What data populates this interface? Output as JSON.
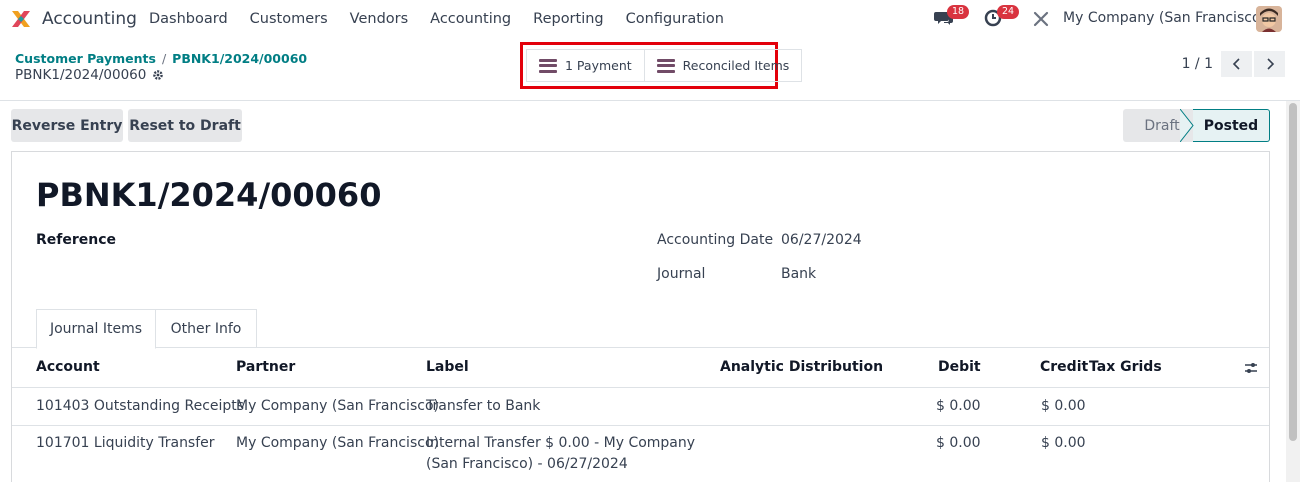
{
  "nav": {
    "app_name": "Accounting",
    "menu": [
      "Dashboard",
      "Customers",
      "Vendors",
      "Accounting",
      "Reporting",
      "Configuration"
    ],
    "messages_count": "18",
    "activities_count": "24",
    "company": "My Company (San Francisco)"
  },
  "breadcrumb": {
    "parent": "Customer Payments",
    "current": "PBNK1/2024/00060",
    "separator": "/"
  },
  "record_name": "PBNK1/2024/00060",
  "smart_buttons": {
    "payment": "1 Payment",
    "reconciled": "Reconciled Items"
  },
  "pager": {
    "value": "1 / 1"
  },
  "actions": {
    "reverse": "Reverse Entry",
    "reset": "Reset to Draft"
  },
  "statusbar": {
    "draft": "Draft",
    "posted": "Posted",
    "current": "Posted"
  },
  "form": {
    "title": "PBNK1/2024/00060",
    "reference_label": "Reference",
    "accounting_date_label": "Accounting Date",
    "accounting_date": "06/27/2024",
    "journal_label": "Journal",
    "journal": "Bank"
  },
  "tabs": [
    "Journal Items",
    "Other Info"
  ],
  "table": {
    "headers": {
      "account": "Account",
      "partner": "Partner",
      "label": "Label",
      "analytic": "Analytic Distribution",
      "debit": "Debit",
      "credit": "Credit",
      "tax": "Tax Grids"
    },
    "rows": [
      {
        "account": "101403 Outstanding Receipts",
        "partner": "My Company (San Francisco)",
        "label": "Transfer to Bank",
        "debit": "$ 0.00",
        "credit": "$ 0.00"
      },
      {
        "account": "101701 Liquidity Transfer",
        "partner": "My Company (San Francisco)",
        "label": "Internal Transfer $ 0.00 - My Company (San Francisco) - 06/27/2024",
        "debit": "$ 0.00",
        "credit": "$ 0.00"
      }
    ]
  },
  "colors": {
    "brand_purple": "#714b67",
    "teal": "#017e84",
    "badge_red": "#d9333f",
    "highlight_red": "#e3000b"
  }
}
